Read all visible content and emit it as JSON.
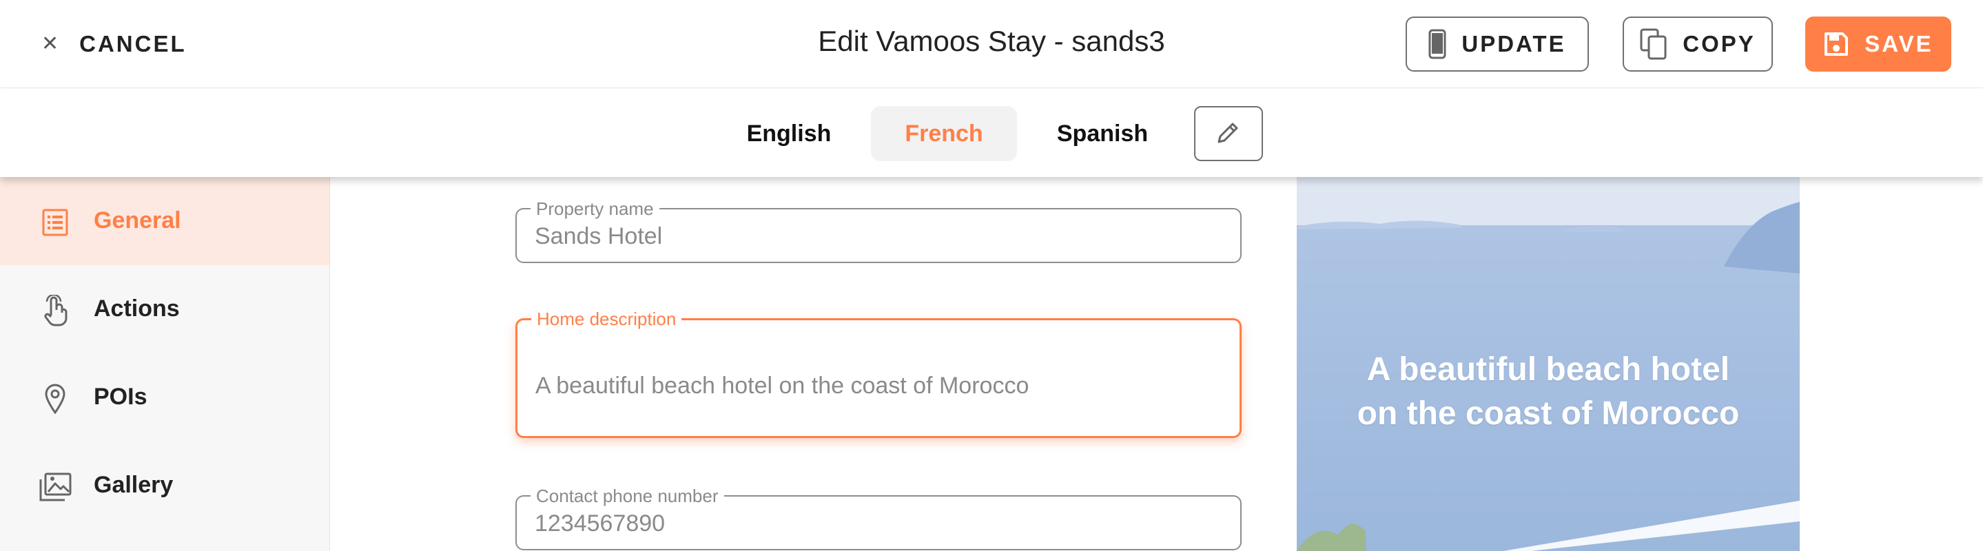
{
  "header": {
    "cancel_label": "CANCEL",
    "title": "Edit Vamoos Stay - sands3",
    "update_label": "UPDATE",
    "copy_label": "COPY",
    "save_label": "SAVE",
    "accent_color": "#ff7f47"
  },
  "languages": {
    "items": [
      {
        "label": "English"
      },
      {
        "label": "French",
        "active": true
      },
      {
        "label": "Spanish"
      }
    ]
  },
  "sidebar": {
    "items": [
      {
        "label": "General",
        "icon": "list-icon",
        "active": true
      },
      {
        "label": "Actions",
        "icon": "touch-icon"
      },
      {
        "label": "POIs",
        "icon": "location-pin-icon"
      },
      {
        "label": "Gallery",
        "icon": "gallery-icon"
      }
    ]
  },
  "form": {
    "property_name": {
      "label": "Property name",
      "value": "Sands Hotel"
    },
    "home_description": {
      "label": "Home description",
      "value": "A beautiful beach hotel on the coast of Morocco"
    },
    "contact_phone": {
      "label": "Contact phone number",
      "value": "1234567890"
    }
  },
  "preview": {
    "line1": "A beautiful beach hotel",
    "line2": "on the coast of Morocco"
  }
}
